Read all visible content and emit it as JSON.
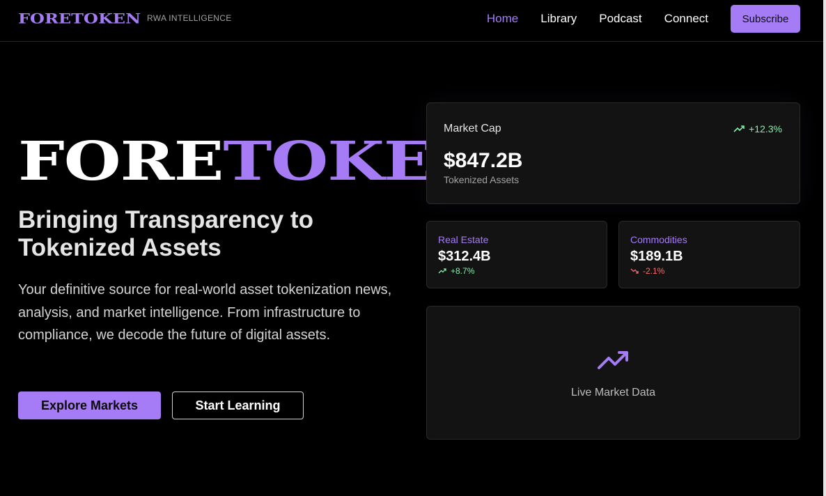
{
  "header": {
    "logo": "FORETOKEN",
    "tagline": "RWA INTELLIGENCE",
    "nav": [
      {
        "label": "Home",
        "active": true
      },
      {
        "label": "Library",
        "active": false
      },
      {
        "label": "Podcast",
        "active": false
      },
      {
        "label": "Connect",
        "active": false
      }
    ],
    "subscribe_label": "Subscribe"
  },
  "hero": {
    "wordmark_part1": "FORE",
    "wordmark_part2": "TOKEN",
    "title": "Bringing Transparency to Tokenized Assets",
    "description": "Your definitive source for real-world asset tokenization news, analysis, and market intelligence. From infrastructure to compliance, we decode the future of digital assets.",
    "primary_cta": "Explore Markets",
    "secondary_cta": "Start Learning"
  },
  "market_cap": {
    "label": "Market Cap",
    "change": "+12.3%",
    "value": "$847.2B",
    "sublabel": "Tokenized Assets"
  },
  "real_estate": {
    "label": "Real Estate",
    "value": "$312.4B",
    "change": "+8.7%"
  },
  "commodities": {
    "label": "Commodities",
    "value": "$189.1B",
    "change": "-2.1%"
  },
  "live": {
    "label": "Live Market Data",
    "icon": "trending-up-icon"
  },
  "colors": {
    "accent": "#a57cf6",
    "background": "#000000",
    "positive": "#86efac",
    "negative": "#f87171"
  }
}
